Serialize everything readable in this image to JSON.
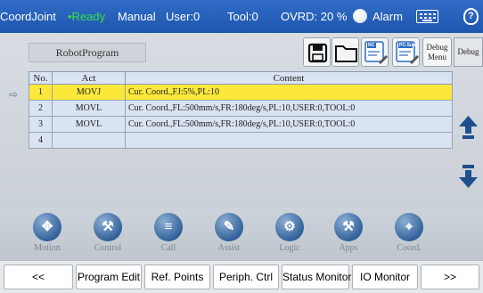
{
  "status_bar": {
    "mode": "CoordJoint",
    "ready": "•Ready",
    "manual": "Manual",
    "user": "User:0",
    "tool": "Tool:0",
    "ovrd": "OVRD: 20 %",
    "alarm": "Alarm",
    "ready_color": "#39e047",
    "help_glyph": "?"
  },
  "program": {
    "tab_label": "RobotProgram",
    "toolbar": {
      "save_icon": "save-icon",
      "open_icon": "folder-icon",
      "nc_label": "NC",
      "pcsub_label": "PC-Sub",
      "debug_menu_line1": "Debug",
      "debug_menu_line2": "Menu",
      "debug_label": "Debug"
    },
    "table": {
      "headers": [
        "No.",
        "Act",
        "Content"
      ],
      "rows": [
        {
          "no": "1",
          "act": "MOVJ",
          "content": "Cur. Coord.,FJ:5%,PL:10",
          "selected": true
        },
        {
          "no": "2",
          "act": "MOVL",
          "content": "Cur. Coord.,FL:500mm/s,FR:180deg/s,PL:10,USER:0,TOOL:0",
          "selected": false
        },
        {
          "no": "3",
          "act": "MOVL",
          "content": "Cur. Coord.,FL:500mm/s,FR:180deg/s,PL:10,USER:0,TOOL:0",
          "selected": false
        },
        {
          "no": "4",
          "act": "",
          "content": "",
          "selected": false
        }
      ],
      "pointer_glyph": "⇨"
    }
  },
  "dock": [
    {
      "label": "Motion",
      "icon": "motion-icon",
      "glyph": "✥"
    },
    {
      "label": "Control",
      "icon": "control-icon",
      "glyph": "⚒"
    },
    {
      "label": "Call",
      "icon": "call-icon",
      "glyph": "≡"
    },
    {
      "label": "Assist",
      "icon": "assist-icon",
      "glyph": "✎"
    },
    {
      "label": "Logic",
      "icon": "logic-icon",
      "glyph": "⚙"
    },
    {
      "label": "Apps",
      "icon": "apps-icon",
      "glyph": "⚒"
    },
    {
      "label": "Coord.",
      "icon": "coord-icon",
      "glyph": "⌖"
    }
  ],
  "bottom_bar": {
    "prev": "<<",
    "program_edit": "Program Edit",
    "ref_points": "Ref. Points",
    "periph_ctrl": "Periph. Ctrl",
    "status_monitor": "Status Monitor",
    "io_monitor": "IO Monitor",
    "next": ">>"
  }
}
